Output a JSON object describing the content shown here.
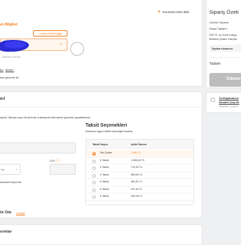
{
  "address_section": {
    "add_corporate_address": "Kurumsal Adres Ekle",
    "title_partial": "en Bilgileri",
    "change_address_button": "Adresi Ekle/Değiştir",
    "address_sent_text": "Adrese Gönder",
    "link_a": "Bu",
    "link_b": "Bedel?",
    "trust_text": "dan güvenle al!"
  },
  "payment_section": {
    "title_partial": "eri",
    "notice": "eçiniz. Banka veya Kredi Kartı kullanarak ödemenizi güvenle yapabilirsiniz.",
    "cvv_label": "CVV",
    "month_value": "Yıl",
    "save_card_text": "ödemek istiyorum",
    "pay_with_label": "ile Öde",
    "pay_with_link": "Oranlar",
    "info_partial": "ormlar"
  },
  "installments": {
    "title": "Taksit Seçenekleri",
    "subtitle": "Kartınıza uygun taksit seçeneğini seçiniz.",
    "col_count": "Taksit Sayısı",
    "col_monthly": "Aylık Ödeme",
    "rows": [
      {
        "label": "Tek Çekim",
        "amount": "2.060 TL",
        "selected": true
      },
      {
        "label": "2 Taksit",
        "amount": "1.058,63 TL",
        "selected": false
      },
      {
        "label": "3 Taksit",
        "amount": "719,40 TL",
        "selected": false
      },
      {
        "label": "4 Taksit",
        "amount": "550,54 TL",
        "selected": false
      },
      {
        "label": "6 Taksit",
        "amount": "381,81 TL",
        "selected": false
      },
      {
        "label": "8 Taksit",
        "amount": "297,45 TL",
        "selected": false
      },
      {
        "label": "9 Taksit",
        "amount": "269,35 TL",
        "selected": false
      }
    ]
  },
  "summary": {
    "title": "Sipariş Özeti",
    "products_total": "Ürünün Toplamı",
    "shipping_total": "Kargo Toplamı",
    "free_shipping_line1": "250 TL ve Üzeri Kargo",
    "free_shipping_line2": "Bedava (Satıcı Karşıla",
    "earnings_badge": "Toplam Kazancın",
    "total_label": "Toplam",
    "pay_button": "Ödeme",
    "terms_line1": "Ön Bilgilendirme",
    "terms_line2": "Mesafeli Satış Sö",
    "terms_line3": "Mobilizm, yinelen"
  },
  "colors": {
    "accent": "#f27a1a",
    "earnings_badge_bg": "#f5f5f5",
    "pay_button_bg": "#bdbdbd"
  }
}
